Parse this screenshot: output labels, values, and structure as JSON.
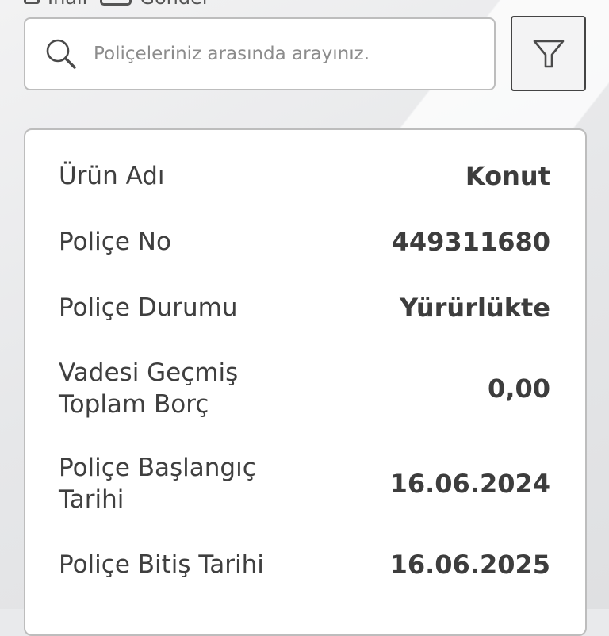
{
  "top_strip": {
    "left_label": "İnali",
    "right_label": "Gönder"
  },
  "search": {
    "placeholder": "Poliçeleriniz arasında arayınız.",
    "icon": "search-icon"
  },
  "filter": {
    "icon": "filter-icon"
  },
  "policy": {
    "rows": [
      {
        "label": "Ürün Adı",
        "value": "Konut"
      },
      {
        "label": "Poliçe No",
        "value": "449311680"
      },
      {
        "label": "Poliçe Durumu",
        "value": "Yürürlükte"
      },
      {
        "label": "Vadesi Geçmiş Toplam Borç",
        "value": "0,00"
      },
      {
        "label": "Poliçe Başlangıç Tarihi",
        "value": "16.06.2024"
      },
      {
        "label": "Poliçe Bitiş Tarihi",
        "value": "16.06.2025"
      }
    ]
  },
  "colors": {
    "background": "#e9eaec",
    "card": "#ffffff",
    "text": "#3f3f3f",
    "border": "#bdbdbd"
  }
}
